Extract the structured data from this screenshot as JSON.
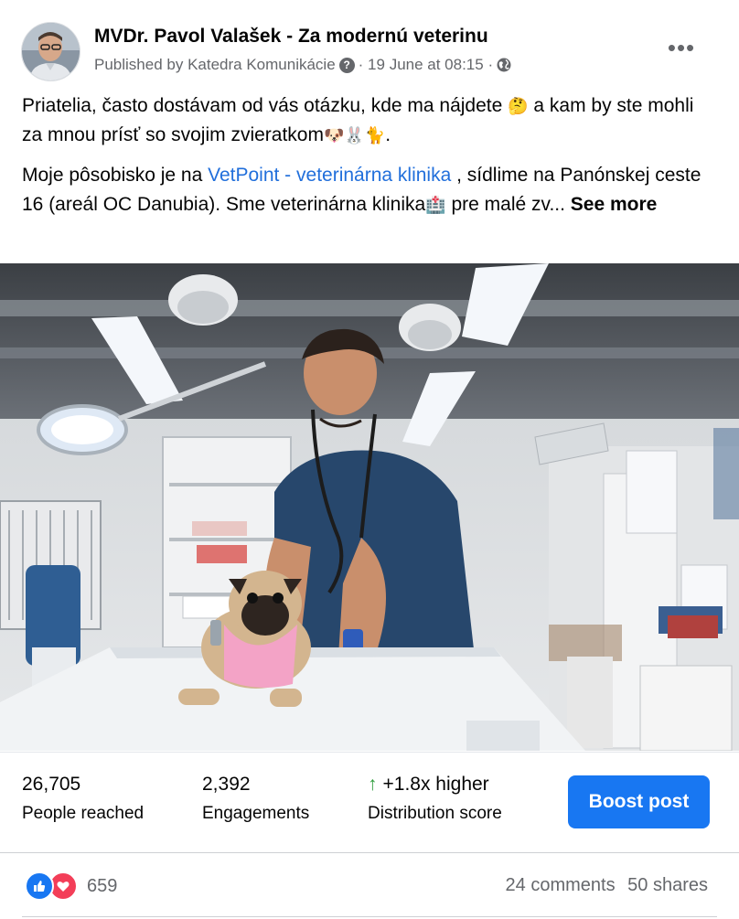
{
  "post": {
    "author": "MVDr. Pavol Valašek - Za modernú veterinu",
    "published_by": "Published by Katedra Komunikácie",
    "date": "· 19 June at 08:15 ·",
    "more_label": "•••"
  },
  "text": {
    "p1_a": "Priatelia, často dostávam od vás otázku, kde ma nájdete ",
    "p1_e1": "🤔",
    "p1_b": " a kam by ste mohli za mnou prísť so svojim zvieratkom",
    "p1_e2": "🐶🐰🐈",
    "p1_c": ".",
    "p2_a": "Moje pôsobisko je na ",
    "p2_link": "VetPoint - veterinárna klinika",
    "p2_b": " , sídlime na Panónskej ceste 16 (areál OC Danubia). Sme veterinárna klinika",
    "p2_e": "🏥",
    "p2_c": " pre malé zv... ",
    "see_more": "See more"
  },
  "stats": {
    "reached_value": "26,705",
    "reached_label": "People reached",
    "engagements_value": "2,392",
    "engagements_label": "Engagements",
    "distribution_value": "+1.8x higher",
    "distribution_label": "Distribution score",
    "boost_label": "Boost post"
  },
  "footer": {
    "reaction_count": "659",
    "comments": "24 comments",
    "shares": "50 shares"
  },
  "colors": {
    "brand_blue": "#1877f2",
    "link_blue": "#216fdb",
    "love_red": "#f33e58",
    "positive_green": "#2e9d3c"
  }
}
